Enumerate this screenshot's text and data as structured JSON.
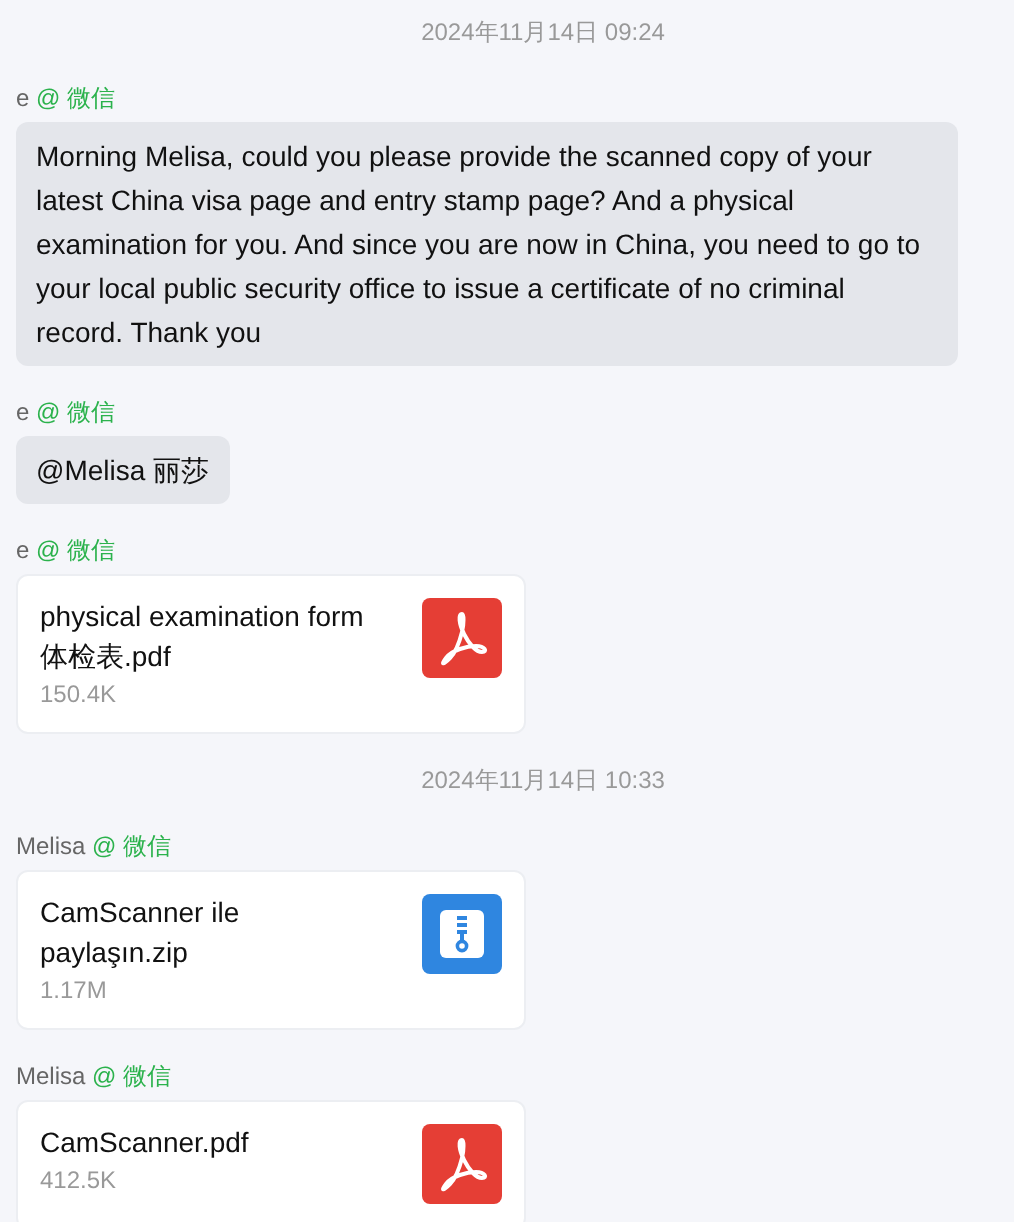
{
  "messages": [
    {
      "kind": "timestamp",
      "text": "2024年11月14日 09:24"
    },
    {
      "kind": "text",
      "sender": "e",
      "source": "@ 微信",
      "text": "Morning Melisa, could you please provide the scanned copy of your latest China visa page and entry stamp page? And a physical examination for you. And since you are now in China, you need to go to your local public security office to issue a certificate of no criminal record. Thank you"
    },
    {
      "kind": "text",
      "sender": "e",
      "source": "@ 微信",
      "text": "@Melisa 丽莎"
    },
    {
      "kind": "pdf_file",
      "sender": "e",
      "source": "@ 微信",
      "name": "physical examination form 体检表.pdf",
      "size": "150.4K"
    },
    {
      "kind": "timestamp",
      "text": "2024年11月14日 10:33"
    },
    {
      "kind": "zip_file",
      "sender": "Melisa",
      "source": "@ 微信",
      "name": "CamScanner ile paylaşın.zip",
      "size": "1.17M"
    },
    {
      "kind": "pdf_file",
      "sender": "Melisa",
      "source": "@ 微信",
      "name": "CamScanner.pdf",
      "size": "412.5K"
    }
  ]
}
